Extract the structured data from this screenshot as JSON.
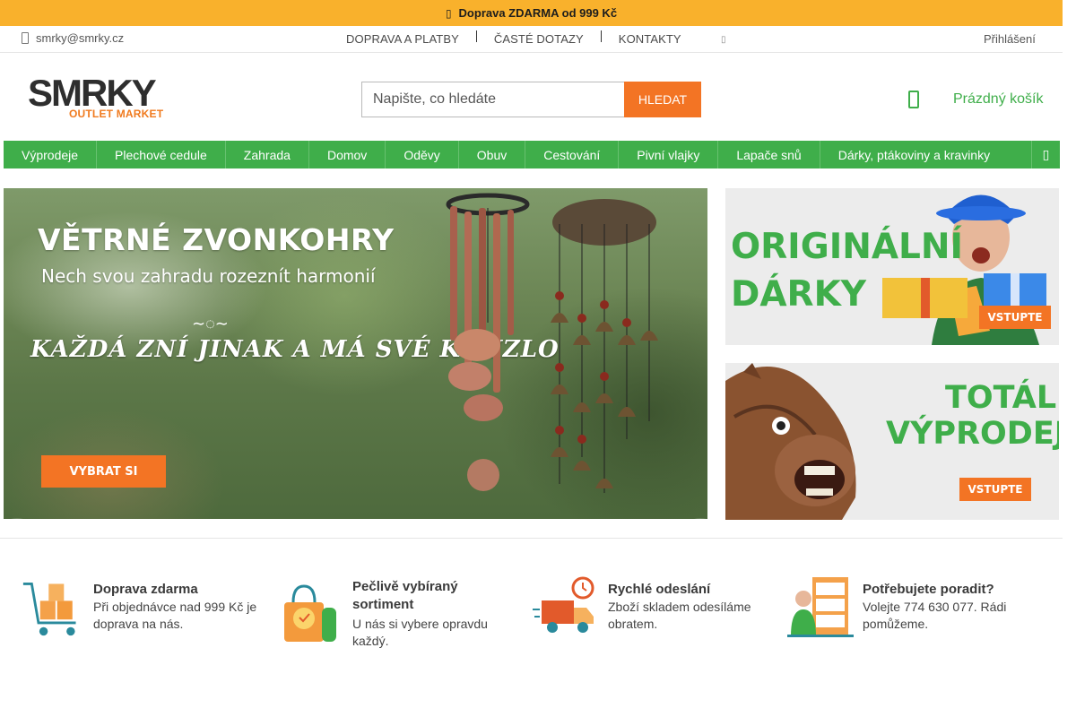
{
  "promo": {
    "icon": "truck-icon",
    "text": "Doprava ZDARMA od 999 Kč"
  },
  "util": {
    "email": "smrky@smrky.cz",
    "links": [
      "DOPRAVA A PLATBY",
      "ČASTÉ DOTAZY",
      "KONTAKTY"
    ],
    "login": "Přihlášení"
  },
  "logo": {
    "line1": "SMRKY",
    "line2": "OUTLET MARKET"
  },
  "search": {
    "placeholder": "Napište, co hledáte",
    "button": "HLEDAT"
  },
  "cart": {
    "label": "Prázdný košík"
  },
  "nav": {
    "items": [
      "Výprodeje",
      "Plechové cedule",
      "Zahrada",
      "Domov",
      "Oděvy",
      "Obuv",
      "Cestování",
      "Pivní vlajky",
      "Lapače snů",
      "Dárky, ptákoviny a kravinky"
    ]
  },
  "hero": {
    "title": "VĚTRNÉ ZVONKOHRY",
    "subtitle": "Nech svou zahradu rozeznít harmonií",
    "tagline": "KAŽDÁ ZNÍ JINAK A MÁ SVÉ KOUZLO",
    "cta": "VYBRAT SI"
  },
  "side_banners": [
    {
      "line1": "ORIGINÁLNÍ",
      "line2": "DÁRKY",
      "cta": "VSTUPTE"
    },
    {
      "line1": "TOTÁLNÍ",
      "line2": "VÝPRODEJ",
      "cta": "VSTUPTE"
    }
  ],
  "features": [
    {
      "title": "Doprava zdarma",
      "desc": "Při objednávce nad 999 Kč je doprava na nás."
    },
    {
      "title": "Pečlivě vybíraný sortiment",
      "desc": "U nás si vybere opravdu každý."
    },
    {
      "title": "Rychlé odeslání",
      "desc": "Zboží skladem odesíláme obratem."
    },
    {
      "title": "Potřebujete poradit?",
      "desc": "Volejte 774 630 077. Rádi pomůžeme."
    }
  ],
  "colors": {
    "accent_green": "#3fae4a",
    "accent_orange": "#f37424",
    "promo_yellow": "#f9b12c"
  }
}
